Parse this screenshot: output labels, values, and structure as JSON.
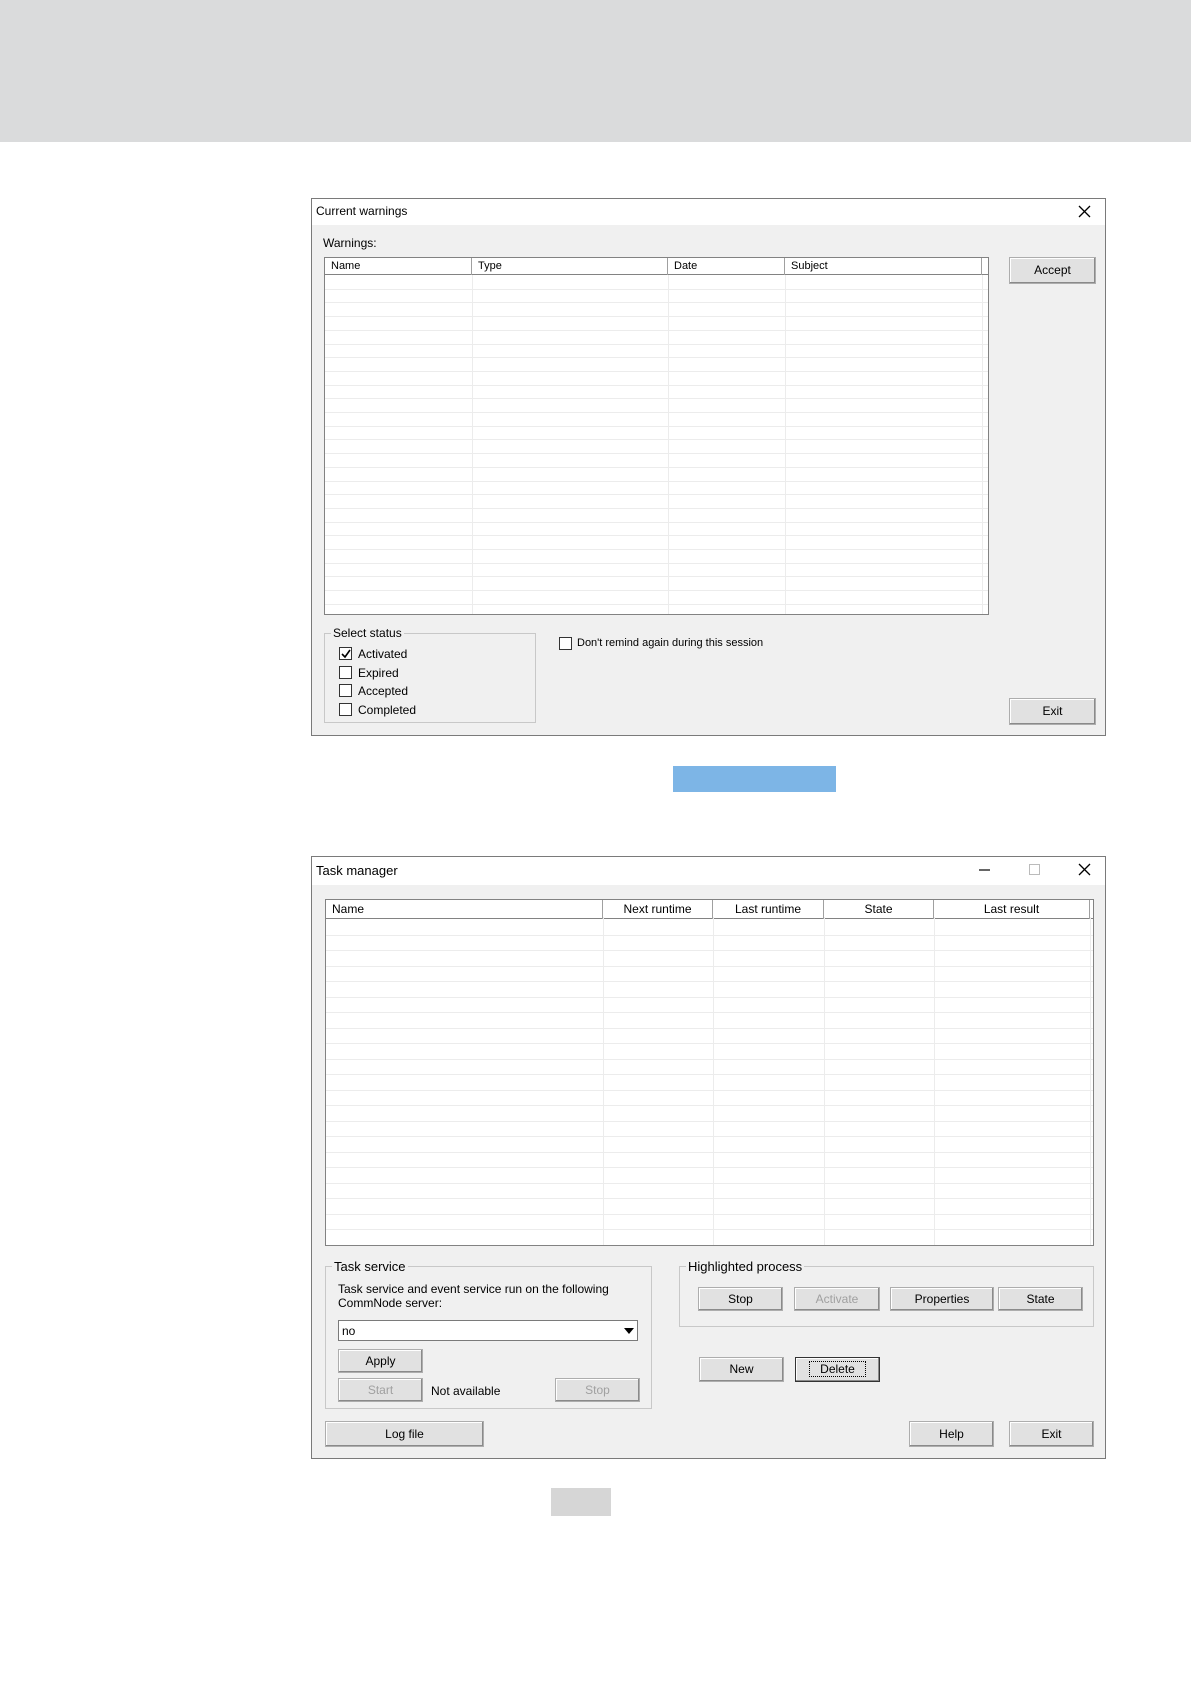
{
  "warnings_window": {
    "title": "Current warnings",
    "warnings_label": "Warnings:",
    "columns": [
      "Name",
      "Type",
      "Date",
      "Subject"
    ],
    "accept_label": "Accept",
    "select_status": {
      "title": "Select status",
      "items": [
        {
          "label": "Activated",
          "checked": true
        },
        {
          "label": "Expired",
          "checked": false
        },
        {
          "label": "Accepted",
          "checked": false
        },
        {
          "label": "Completed",
          "checked": false
        }
      ]
    },
    "dont_remind_label": "Don't remind again during this session",
    "exit_label": "Exit"
  },
  "task_window": {
    "title": "Task manager",
    "columns": [
      "Name",
      "Next runtime",
      "Last runtime",
      "State",
      "Last result"
    ],
    "task_service": {
      "title": "Task service",
      "description": "Task service and event service run on the following CommNode server:",
      "server_value": "no",
      "apply_label": "Apply",
      "start_label": "Start",
      "status_text": "Not available",
      "stop_label": "Stop"
    },
    "highlighted_process": {
      "title": "Highlighted process",
      "stop_label": "Stop",
      "activate_label": "Activate",
      "properties_label": "Properties",
      "state_label": "State"
    },
    "new_label": "New",
    "delete_label": "Delete",
    "logfile_label": "Log file",
    "help_label": "Help",
    "exit_label": "Exit"
  },
  "colors": {
    "header_band": "#dadbdc",
    "dialog_bg": "#f0f0f0",
    "caption_marker": "#7db5e6"
  }
}
